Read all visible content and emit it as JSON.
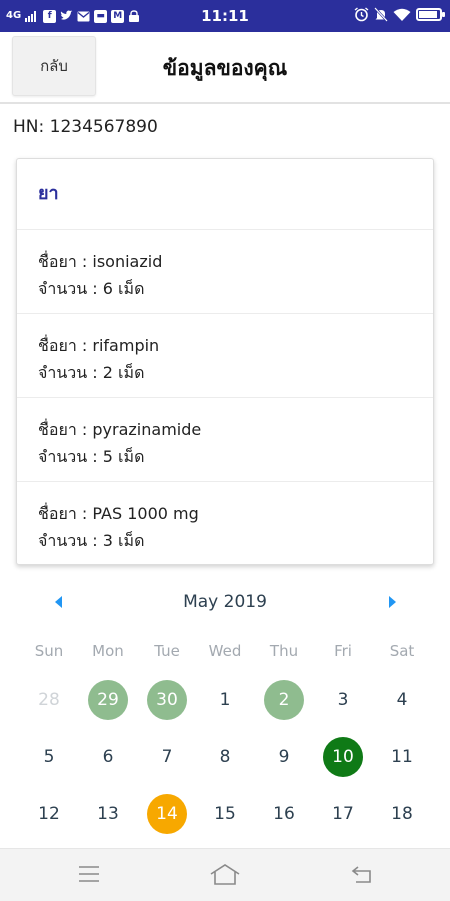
{
  "status_bar": {
    "network": "4G",
    "time": "11:11",
    "icons": [
      "signal-icon",
      "facebook-icon",
      "twitter-icon",
      "mail-icon",
      "message-icon",
      "gmail-icon",
      "lock-icon",
      "alarm-icon",
      "silent-icon",
      "wifi-icon",
      "battery-icon"
    ]
  },
  "header": {
    "back_label": "กลับ",
    "title": "ข้อมูลของคุณ"
  },
  "hn": "HN: 1234567890",
  "medication": {
    "title": "ยา",
    "items": [
      {
        "name": "ชื่อยา : isoniazid",
        "amount": "จำนวน : 6 เม็ด"
      },
      {
        "name": "ชื่อยา : rifampin",
        "amount": "จำนวน : 2 เม็ด"
      },
      {
        "name": "ชื่อยา : pyrazinamide",
        "amount": "จำนวน : 5 เม็ด"
      },
      {
        "name": "ชื่อยา : PAS 1000 mg",
        "amount": "จำนวน : 3 เม็ด"
      }
    ]
  },
  "calendar": {
    "month": "May 2019",
    "weekdays": [
      "Sun",
      "Mon",
      "Tue",
      "Wed",
      "Thu",
      "Fri",
      "Sat"
    ],
    "rows": [
      [
        "28",
        "29",
        "30",
        "1",
        "2",
        "3",
        "4"
      ],
      [
        "5",
        "6",
        "7",
        "8",
        "9",
        "10",
        "11"
      ],
      [
        "12",
        "13",
        "14",
        "15",
        "16",
        "17",
        "18"
      ]
    ],
    "colors": {
      "marked": "#8fbc8f",
      "selected": "#0f7a16",
      "today": "#f7a800",
      "arrow": "#2196f3"
    }
  },
  "nav_bar": {
    "icons": [
      "menu-icon",
      "home-icon",
      "back-icon"
    ]
  }
}
